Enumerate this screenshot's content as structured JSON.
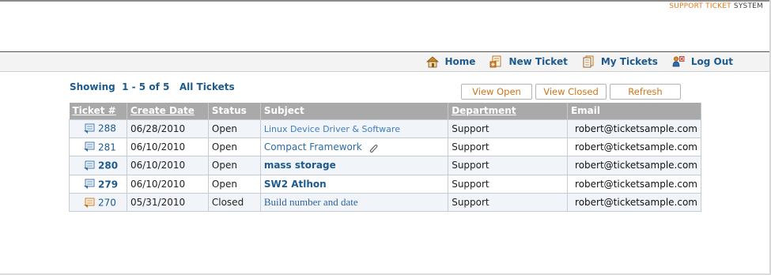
{
  "brand": {
    "part1": "Support Ticket",
    "part2": "System"
  },
  "nav": [
    {
      "label": "Home",
      "icon": "home-icon"
    },
    {
      "label": "New Ticket",
      "icon": "new-ticket-icon"
    },
    {
      "label": "My Tickets",
      "icon": "my-tickets-icon"
    },
    {
      "label": "Log Out",
      "icon": "logout-icon"
    }
  ],
  "showing": "Showing  1 - 5 of 5   All Tickets",
  "buttons": {
    "view_open": "View Open",
    "view_closed": "View Closed",
    "refresh": "Refresh"
  },
  "table": {
    "headers": [
      "Ticket #",
      "Create Date",
      "Status",
      "Subject",
      "Department",
      "Email"
    ],
    "rows": [
      {
        "ticket": "288",
        "date": "06/28/2010",
        "status": "Open",
        "subject": "Linux Device Driver & Software",
        "dept": "Support",
        "email": "robert@ticketsample.com",
        "attachment": false
      },
      {
        "ticket": "281",
        "date": "06/10/2010",
        "status": "Open",
        "subject": "Compact Framework",
        "dept": "Support",
        "email": "robert@ticketsample.com",
        "attachment": true
      },
      {
        "ticket": "280",
        "date": "06/10/2010",
        "status": "Open",
        "subject": "mass storage",
        "dept": "Support",
        "email": "robert@ticketsample.com",
        "attachment": false
      },
      {
        "ticket": "279",
        "date": "06/10/2010",
        "status": "Open",
        "subject": "SW2 Atlhon",
        "dept": "Support",
        "email": "robert@ticketsample.com",
        "attachment": false
      },
      {
        "ticket": "270",
        "date": "05/31/2010",
        "status": "Closed",
        "subject": "Build number and date",
        "dept": "Support",
        "email": "robert@ticketsample.com",
        "attachment": false
      }
    ]
  },
  "colors": {
    "link": "#1d5a8e",
    "accent": "#e07a1c",
    "header_bg": "#a9a9a9",
    "row_alt": "#f1f5fa"
  }
}
